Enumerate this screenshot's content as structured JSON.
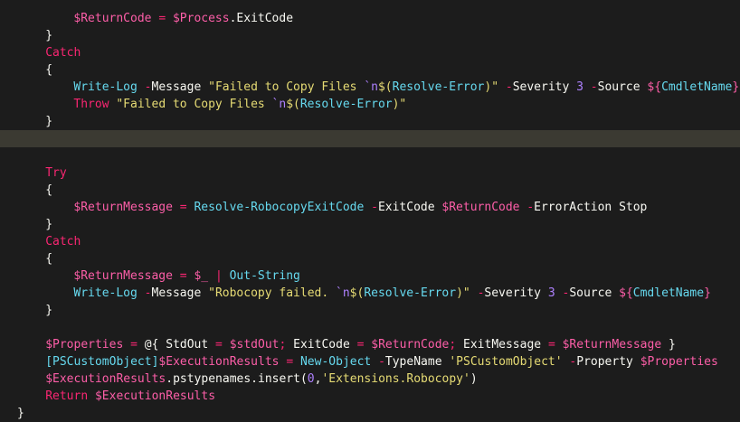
{
  "editor": {
    "highlighted_line": 7,
    "colors": {
      "background": "#1c1c1c",
      "highlight": "#3b3a32",
      "variable": "#fd5ea8",
      "command": "#66d9ef",
      "string": "#e6db74",
      "keyword": "#f92672",
      "number": "#ae81ff",
      "plain": "#f8f8f2"
    },
    "lines": [
      {
        "indent": "        ",
        "tokens": [
          {
            "c": "var",
            "t": "$ReturnCode"
          },
          {
            "c": "plain",
            "t": " "
          },
          {
            "c": "op",
            "t": "="
          },
          {
            "c": "plain",
            "t": " "
          },
          {
            "c": "var",
            "t": "$Process"
          },
          {
            "c": "plain",
            "t": ".ExitCode"
          }
        ]
      },
      {
        "indent": "    ",
        "tokens": [
          {
            "c": "brc",
            "t": "}"
          }
        ]
      },
      {
        "indent": "    ",
        "tokens": [
          {
            "c": "kw",
            "t": "Catch"
          }
        ]
      },
      {
        "indent": "    ",
        "tokens": [
          {
            "c": "brc",
            "t": "{"
          }
        ]
      },
      {
        "indent": "        ",
        "tokens": [
          {
            "c": "cmd",
            "t": "Write-Log"
          },
          {
            "c": "plain",
            "t": " "
          },
          {
            "c": "op",
            "t": "-"
          },
          {
            "c": "param",
            "t": "Message"
          },
          {
            "c": "plain",
            "t": " "
          },
          {
            "c": "str",
            "t": "\"Failed to Copy Files "
          },
          {
            "c": "esc",
            "t": "`n"
          },
          {
            "c": "str",
            "t": "$("
          },
          {
            "c": "cmd",
            "t": "Resolve-Error"
          },
          {
            "c": "str",
            "t": ")\""
          },
          {
            "c": "plain",
            "t": " "
          },
          {
            "c": "op",
            "t": "-"
          },
          {
            "c": "param",
            "t": "Severity"
          },
          {
            "c": "plain",
            "t": " "
          },
          {
            "c": "num",
            "t": "3"
          },
          {
            "c": "plain",
            "t": " "
          },
          {
            "c": "op",
            "t": "-"
          },
          {
            "c": "param",
            "t": "Source"
          },
          {
            "c": "plain",
            "t": " "
          },
          {
            "c": "var",
            "t": "${"
          },
          {
            "c": "cmd",
            "t": "CmdletName"
          },
          {
            "c": "var",
            "t": "}"
          }
        ]
      },
      {
        "indent": "        ",
        "tokens": [
          {
            "c": "kw",
            "t": "Throw"
          },
          {
            "c": "plain",
            "t": " "
          },
          {
            "c": "str",
            "t": "\"Failed to Copy Files "
          },
          {
            "c": "esc",
            "t": "`n"
          },
          {
            "c": "str",
            "t": "$("
          },
          {
            "c": "cmd",
            "t": "Resolve-Error"
          },
          {
            "c": "str",
            "t": ")\""
          }
        ]
      },
      {
        "indent": "    ",
        "tokens": [
          {
            "c": "brc",
            "t": "}"
          }
        ]
      },
      {
        "indent": "",
        "tokens": []
      },
      {
        "indent": "",
        "tokens": []
      },
      {
        "indent": "    ",
        "tokens": [
          {
            "c": "kw",
            "t": "Try"
          }
        ]
      },
      {
        "indent": "    ",
        "tokens": [
          {
            "c": "brc",
            "t": "{"
          }
        ]
      },
      {
        "indent": "        ",
        "tokens": [
          {
            "c": "var",
            "t": "$ReturnMessage"
          },
          {
            "c": "plain",
            "t": " "
          },
          {
            "c": "op",
            "t": "="
          },
          {
            "c": "plain",
            "t": " "
          },
          {
            "c": "cmd",
            "t": "Resolve-RobocopyExitCode"
          },
          {
            "c": "plain",
            "t": " "
          },
          {
            "c": "op",
            "t": "-"
          },
          {
            "c": "param",
            "t": "ExitCode"
          },
          {
            "c": "plain",
            "t": " "
          },
          {
            "c": "var",
            "t": "$ReturnCode"
          },
          {
            "c": "plain",
            "t": " "
          },
          {
            "c": "op",
            "t": "-"
          },
          {
            "c": "param",
            "t": "ErrorAction Stop"
          }
        ]
      },
      {
        "indent": "    ",
        "tokens": [
          {
            "c": "brc",
            "t": "}"
          }
        ]
      },
      {
        "indent": "    ",
        "tokens": [
          {
            "c": "kw",
            "t": "Catch"
          }
        ]
      },
      {
        "indent": "    ",
        "tokens": [
          {
            "c": "brc",
            "t": "{"
          }
        ]
      },
      {
        "indent": "        ",
        "tokens": [
          {
            "c": "var",
            "t": "$ReturnMessage"
          },
          {
            "c": "plain",
            "t": " "
          },
          {
            "c": "op",
            "t": "="
          },
          {
            "c": "plain",
            "t": " "
          },
          {
            "c": "var",
            "t": "$_"
          },
          {
            "c": "plain",
            "t": " "
          },
          {
            "c": "op",
            "t": "|"
          },
          {
            "c": "plain",
            "t": " "
          },
          {
            "c": "cmd",
            "t": "Out-String"
          }
        ]
      },
      {
        "indent": "        ",
        "tokens": [
          {
            "c": "cmd",
            "t": "Write-Log"
          },
          {
            "c": "plain",
            "t": " "
          },
          {
            "c": "op",
            "t": "-"
          },
          {
            "c": "param",
            "t": "Message"
          },
          {
            "c": "plain",
            "t": " "
          },
          {
            "c": "str",
            "t": "\"Robocopy failed. "
          },
          {
            "c": "esc",
            "t": "`n"
          },
          {
            "c": "str",
            "t": "$("
          },
          {
            "c": "cmd",
            "t": "Resolve-Error"
          },
          {
            "c": "str",
            "t": ")\""
          },
          {
            "c": "plain",
            "t": " "
          },
          {
            "c": "op",
            "t": "-"
          },
          {
            "c": "param",
            "t": "Severity"
          },
          {
            "c": "plain",
            "t": " "
          },
          {
            "c": "num",
            "t": "3"
          },
          {
            "c": "plain",
            "t": " "
          },
          {
            "c": "op",
            "t": "-"
          },
          {
            "c": "param",
            "t": "Source"
          },
          {
            "c": "plain",
            "t": " "
          },
          {
            "c": "var",
            "t": "${"
          },
          {
            "c": "cmd",
            "t": "CmdletName"
          },
          {
            "c": "var",
            "t": "}"
          }
        ]
      },
      {
        "indent": "    ",
        "tokens": [
          {
            "c": "brc",
            "t": "}"
          }
        ]
      },
      {
        "indent": "",
        "tokens": []
      },
      {
        "indent": "    ",
        "tokens": [
          {
            "c": "var",
            "t": "$Properties"
          },
          {
            "c": "plain",
            "t": " "
          },
          {
            "c": "op",
            "t": "="
          },
          {
            "c": "plain",
            "t": " "
          },
          {
            "c": "plain",
            "t": "@{ StdOut "
          },
          {
            "c": "op",
            "t": "="
          },
          {
            "c": "plain",
            "t": " "
          },
          {
            "c": "var",
            "t": "$stdOut"
          },
          {
            "c": "op",
            "t": ";"
          },
          {
            "c": "plain",
            "t": " ExitCode "
          },
          {
            "c": "op",
            "t": "="
          },
          {
            "c": "plain",
            "t": " "
          },
          {
            "c": "var",
            "t": "$ReturnCode"
          },
          {
            "c": "op",
            "t": ";"
          },
          {
            "c": "plain",
            "t": " ExitMessage "
          },
          {
            "c": "op",
            "t": "="
          },
          {
            "c": "plain",
            "t": " "
          },
          {
            "c": "var",
            "t": "$ReturnMessage"
          },
          {
            "c": "plain",
            "t": " }"
          }
        ]
      },
      {
        "indent": "    ",
        "tokens": [
          {
            "c": "type",
            "t": "[PSCustomObject]"
          },
          {
            "c": "var",
            "t": "$ExecutionResults"
          },
          {
            "c": "plain",
            "t": " "
          },
          {
            "c": "op",
            "t": "="
          },
          {
            "c": "plain",
            "t": " "
          },
          {
            "c": "cmd",
            "t": "New-Object"
          },
          {
            "c": "plain",
            "t": " "
          },
          {
            "c": "op",
            "t": "-"
          },
          {
            "c": "param",
            "t": "TypeName"
          },
          {
            "c": "plain",
            "t": " "
          },
          {
            "c": "str",
            "t": "'PSCustomObject'"
          },
          {
            "c": "plain",
            "t": " "
          },
          {
            "c": "op",
            "t": "-"
          },
          {
            "c": "param",
            "t": "Property"
          },
          {
            "c": "plain",
            "t": " "
          },
          {
            "c": "var",
            "t": "$Properties"
          }
        ]
      },
      {
        "indent": "    ",
        "tokens": [
          {
            "c": "var",
            "t": "$ExecutionResults"
          },
          {
            "c": "plain",
            "t": ".pstypenames.insert("
          },
          {
            "c": "num",
            "t": "0"
          },
          {
            "c": "plain",
            "t": ","
          },
          {
            "c": "str",
            "t": "'Extensions.Robocopy'"
          },
          {
            "c": "plain",
            "t": ")"
          }
        ]
      },
      {
        "indent": "    ",
        "tokens": [
          {
            "c": "kw",
            "t": "Return"
          },
          {
            "c": "plain",
            "t": " "
          },
          {
            "c": "var",
            "t": "$ExecutionResults"
          }
        ]
      },
      {
        "indent": "",
        "tokens": [
          {
            "c": "brc",
            "t": "}"
          }
        ]
      }
    ]
  }
}
